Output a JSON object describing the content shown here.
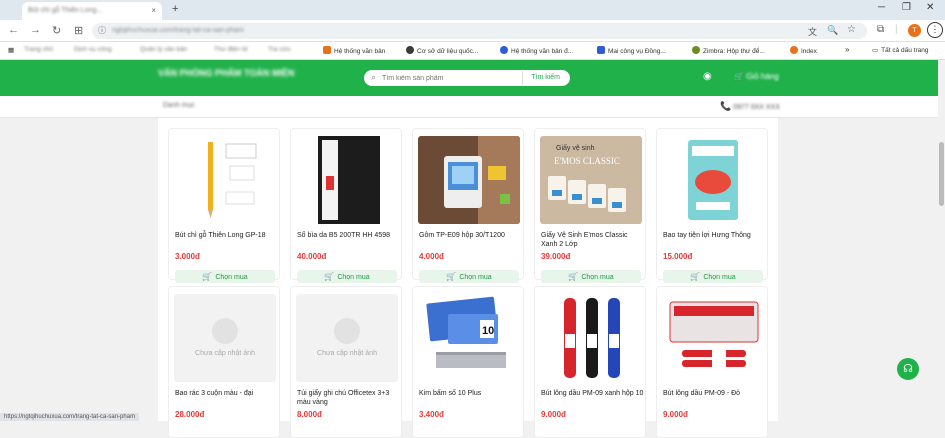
{
  "browser": {
    "tab_title": "Bút chì gỗ Thiên Long...",
    "tab_close": "×",
    "new_tab": "+",
    "url": "ngtqihuchuxua.com/trang-tat-ca-san-pham",
    "win_min": "─",
    "win_max": "❐",
    "win_close": "✕",
    "avatar_letter": "T",
    "menu": "⋮",
    "bookmarks": [
      {
        "label": "Hệ thống văn bản",
        "color": "#e8711a"
      },
      {
        "label": "Cơ sở dữ liệu quốc...",
        "color": "#3b3b3b"
      },
      {
        "label": "Hệ thống văn bản đ...",
        "color": "#2f5bd6"
      },
      {
        "label": "Mai công vụ Đồng...",
        "color": "#2f5bd6"
      },
      {
        "label": "Zimbra: Hộp thư để...",
        "color": "#6b8e23"
      },
      {
        "label": "Index",
        "color": "#e8711a"
      }
    ],
    "bookmarks_more": "»",
    "all_bookmarks": "Tất cả dấu trang"
  },
  "header": {
    "logo": "VĂN PHÒNG PHẨM TOÀN MIỀN",
    "search_placeholder": "Tìm kiếm sản phẩm",
    "search_button": "Tìm kiếm",
    "cart_label": "Giỏ hàng"
  },
  "subbar": {
    "left_text": "Danh mục",
    "phone": "0977 0XX XXX"
  },
  "products": [
    {
      "name": "Bút chì gỗ Thiên Long GP-18",
      "price": "3.000đ",
      "buy": "Chọn mua",
      "image": "pencil"
    },
    {
      "name": "Sổ bìa da B5 200TR HH 4598",
      "price": "40.000đ",
      "buy": "Chọn mua",
      "image": "notebook"
    },
    {
      "name": "Gôm TP-E09 hộp 30/T1200",
      "price": "4.000đ",
      "buy": "Chọn mua",
      "image": "eraser"
    },
    {
      "name": "Giấy Vệ Sinh E'mos Classic Xanh 2 Lớp",
      "price": "39.000đ",
      "buy": "Chọn mua",
      "image": "tissue"
    },
    {
      "name": "Bao tay tiện lợi Hưng Thông",
      "price": "15.000đ",
      "buy": "Chọn mua",
      "image": "gloves"
    },
    {
      "name": "Bao rác 3 cuộn màu - đại",
      "price": "28.000đ",
      "buy": "Chọn mua",
      "image": "placeholder",
      "placeholder_text": "Chưa cập nhật ảnh"
    },
    {
      "name": "Túi giấy ghi chú Officetex 3+3 màu vàng",
      "price": "8.000đ",
      "buy": "Chọn mua",
      "image": "placeholder",
      "placeholder_text": "Chưa cập nhật ảnh"
    },
    {
      "name": "Kim bấm số 10 Plus",
      "price": "3.400đ",
      "buy": "Chọn mua",
      "image": "staples"
    },
    {
      "name": "Bút lông dầu PM-09 xanh hộp 10",
      "price": "9.000đ",
      "buy": "Chọn mua",
      "image": "markers"
    },
    {
      "name": "Bút lông dầu PM-09 - Đỏ",
      "price": "9.000đ",
      "buy": "Chọn mua",
      "image": "redmarker"
    }
  ],
  "status_url": "https://ngtqihuchuxua.com/trang-tat-ca-san-pham",
  "colors": {
    "brand_green": "#21b14b",
    "price_red": "#e53935"
  }
}
